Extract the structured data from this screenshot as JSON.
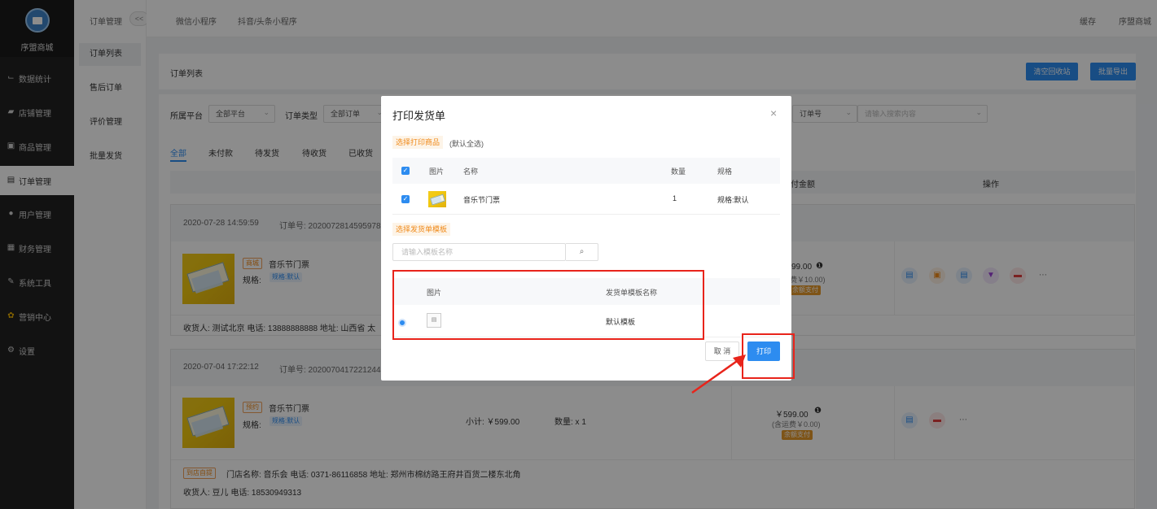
{
  "nav": {
    "brand": "序盟商城",
    "items": [
      {
        "label": "数据统计",
        "icon": "chart-icon"
      },
      {
        "label": "店铺管理",
        "icon": "store-icon"
      },
      {
        "label": "商品管理",
        "icon": "goods-icon"
      },
      {
        "label": "订单管理",
        "icon": "order-icon"
      },
      {
        "label": "用户管理",
        "icon": "user-icon"
      },
      {
        "label": "财务管理",
        "icon": "finance-icon"
      },
      {
        "label": "系统工具",
        "icon": "wrench-icon"
      },
      {
        "label": "营销中心",
        "icon": "marketing-icon"
      },
      {
        "label": "设置",
        "icon": "settings-icon"
      }
    ]
  },
  "subnav": {
    "title": "订单管理",
    "collapse": "<<",
    "items": [
      "订单列表",
      "售后订单",
      "评价管理",
      "批量发货"
    ]
  },
  "topbar": {
    "tabs": [
      "微信小程序",
      "抖音/头条小程序"
    ],
    "cache": "缓存",
    "shop": "序盟商城"
  },
  "page": {
    "title": "订单列表",
    "btn_clear": "清空回收站",
    "btn_export": "批量导出"
  },
  "filters": {
    "platform_label": "所属平台",
    "platform_value": "全部平台",
    "type_label": "订单类型",
    "type_value": "全部订单",
    "order_no_select": "订单号",
    "search_placeholder": "请输入搜索内容"
  },
  "order_tabs": [
    "全部",
    "未付款",
    "待发货",
    "待收货",
    "已收货"
  ],
  "table_headers": {
    "pay": "付金额",
    "action": "操作"
  },
  "orders": [
    {
      "time": "2020-07-28 14:59:59",
      "order_no": "订单号: 2020072814595978",
      "tag": "商城",
      "name": "音乐节门票",
      "spec_label": "规格:",
      "spec": "规格:默认",
      "amount": "99.00",
      "freight": "费￥10.00)",
      "pay_badge": "余额支付",
      "address": "收货人: 测试北京 电话: 13888888888 地址: 山西省 太"
    },
    {
      "time": "2020-07-04 17:22:12",
      "order_no": "订单号: 2020070417221244",
      "tag": "预约",
      "name": "音乐节门票",
      "spec_label": "规格:",
      "spec": "规格:默认",
      "subtotal": "小计:  ￥599.00",
      "qty": "数量:  x 1",
      "amount": "￥599.00",
      "freight": "(含运费￥0.00)",
      "pay_badge": "余额支付",
      "store_tag": "到店自提",
      "store": "门店名称: 音乐会 电话: 0371-86116858 地址: 郑州市棉纺路王府井百货二楼东北角",
      "address": "收货人: 豆儿 电话: 18530949313"
    }
  ],
  "modal": {
    "title": "打印发货单",
    "close": "×",
    "select_goods_label": "选择打印商品",
    "select_goods_hint": "(默认全选)",
    "goods_headers": {
      "pic": "图片",
      "name": "名称",
      "qty": "数量",
      "spec": "规格"
    },
    "goods": [
      {
        "name": "音乐节门票",
        "qty": "1",
        "spec": "规格:默认"
      }
    ],
    "select_template_label": "选择发货单模板",
    "template_search_placeholder": "请输入模板名称",
    "template_headers": {
      "pic": "图片",
      "name": "发货单模板名称"
    },
    "templates": [
      {
        "name": "默认模板"
      }
    ],
    "cancel": "取 消",
    "print": "打印"
  },
  "colors": {
    "primary": "#2d8cf0",
    "highlight": "#e8241b",
    "orange": "#f08a1a"
  }
}
